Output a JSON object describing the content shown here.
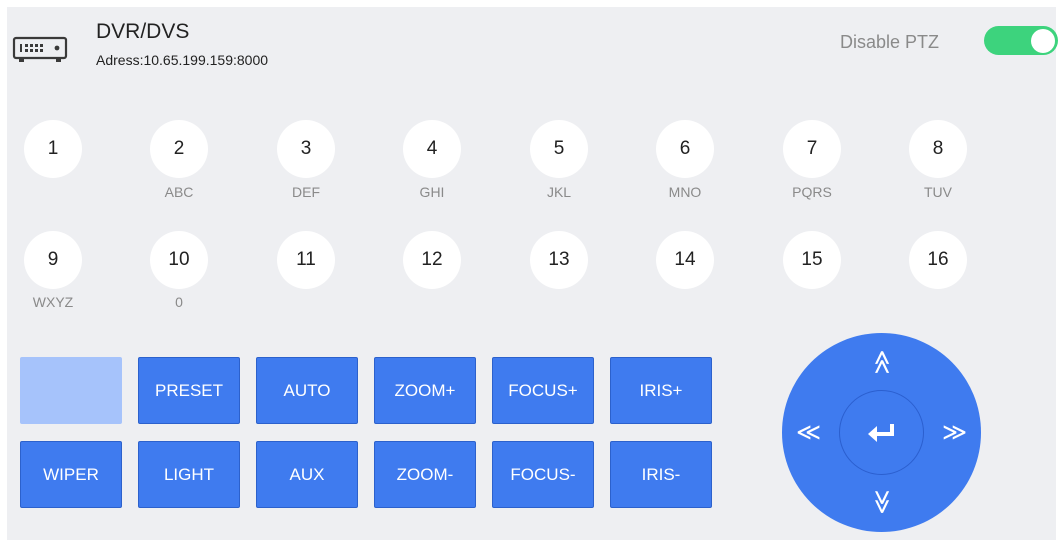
{
  "header": {
    "title": "DVR/DVS",
    "address": "Adress:10.65.199.159:8000",
    "ptz_label": "Disable PTZ",
    "ptz_enabled": true,
    "toggle_color": "#3dd37d"
  },
  "keypad": {
    "row1": [
      {
        "num": "1",
        "sub": ""
      },
      {
        "num": "2",
        "sub": "ABC"
      },
      {
        "num": "3",
        "sub": "DEF"
      },
      {
        "num": "4",
        "sub": "GHI"
      },
      {
        "num": "5",
        "sub": "JKL"
      },
      {
        "num": "6",
        "sub": "MNO"
      },
      {
        "num": "7",
        "sub": "PQRS"
      },
      {
        "num": "8",
        "sub": "TUV"
      }
    ],
    "row2": [
      {
        "num": "9",
        "sub": "WXYZ"
      },
      {
        "num": "10",
        "sub": "0"
      },
      {
        "num": "11",
        "sub": ""
      },
      {
        "num": "12",
        "sub": ""
      },
      {
        "num": "13",
        "sub": ""
      },
      {
        "num": "14",
        "sub": ""
      },
      {
        "num": "15",
        "sub": ""
      },
      {
        "num": "16",
        "sub": ""
      }
    ]
  },
  "controls": {
    "row1": [
      "",
      "PRESET",
      "AUTO",
      "ZOOM+",
      "FOCUS+",
      "IRIS+"
    ],
    "row2": [
      "WIPER",
      "LIGHT",
      "AUX",
      "ZOOM-",
      "FOCUS-",
      "IRIS-"
    ],
    "accent_color": "#3f7bef"
  },
  "dpad": {
    "up": "≪",
    "down": "≫",
    "left": "≪",
    "right": "≫",
    "center_icon": "enter-icon"
  }
}
